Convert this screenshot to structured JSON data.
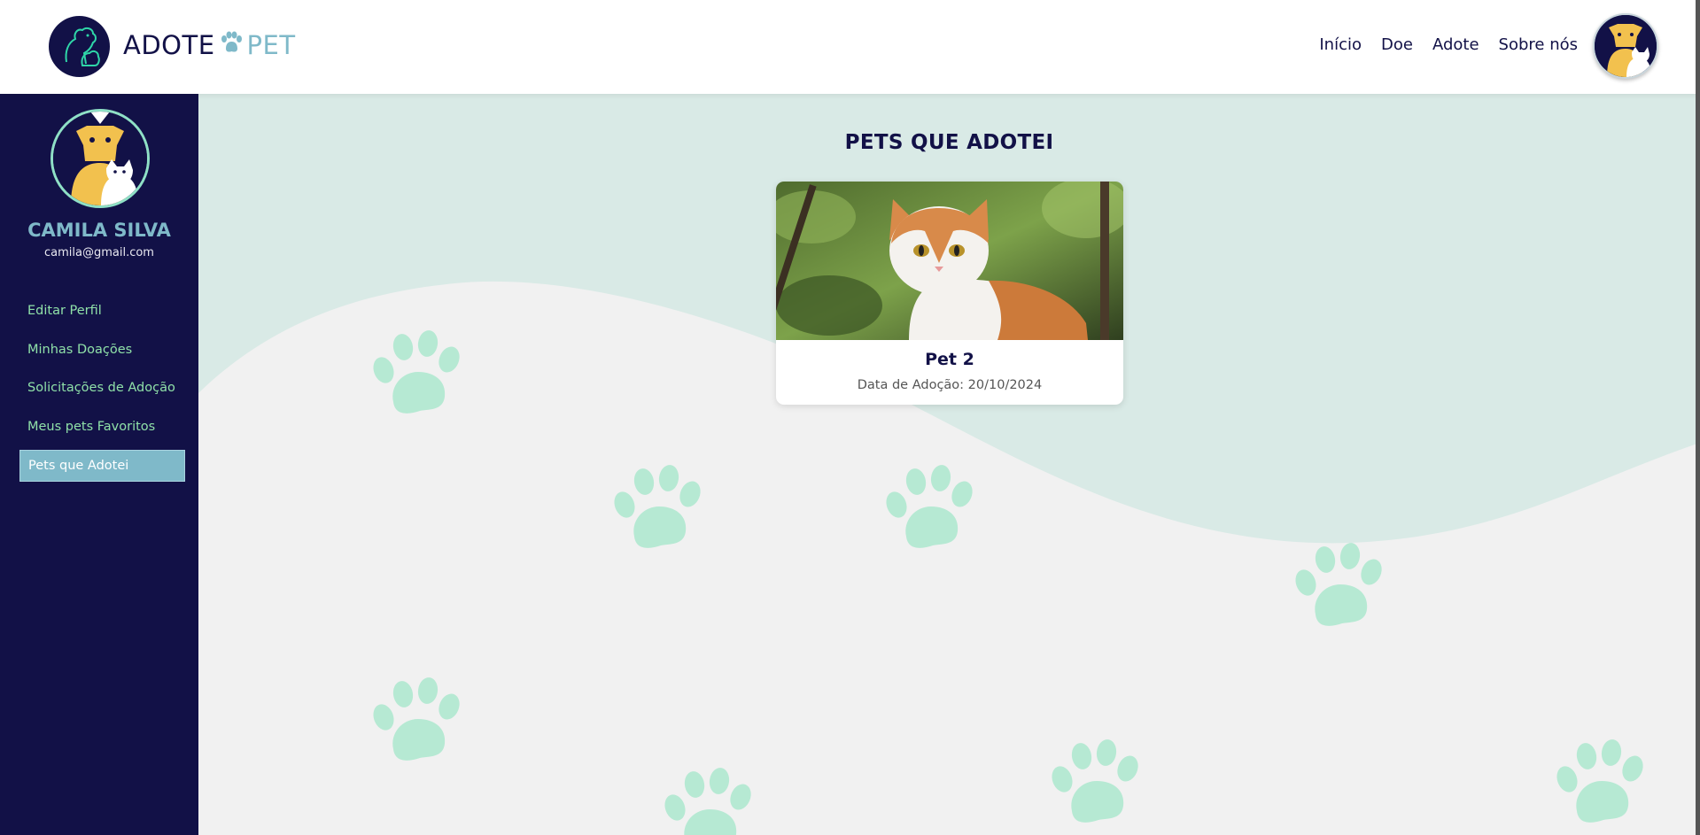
{
  "header": {
    "brand_part1": "ADOTE",
    "brand_part2": "PET",
    "nav": [
      "Início",
      "Doe",
      "Adote",
      "Sobre nós"
    ]
  },
  "profile": {
    "name": "CAMILA SILVA",
    "email": "camila@gmail.com"
  },
  "sidebar": {
    "items": [
      {
        "label": "Editar Perfil",
        "active": false
      },
      {
        "label": "Minhas Doações",
        "active": false
      },
      {
        "label": "Solicitações de Adoção",
        "active": false
      },
      {
        "label": "Meus pets Favoritos",
        "active": false
      },
      {
        "label": "Pets que Adotei",
        "active": true
      }
    ]
  },
  "main": {
    "title": "PETS QUE ADOTEI",
    "pets": [
      {
        "name": "Pet 2",
        "adoption_date": "Data de Adoção: 20/10/2024"
      }
    ]
  },
  "colors": {
    "navy": "#121147",
    "teal": "#7fb9c9",
    "mint": "#8fe0a8",
    "wave": "#d9eae6",
    "paw": "#b6e9d3"
  }
}
